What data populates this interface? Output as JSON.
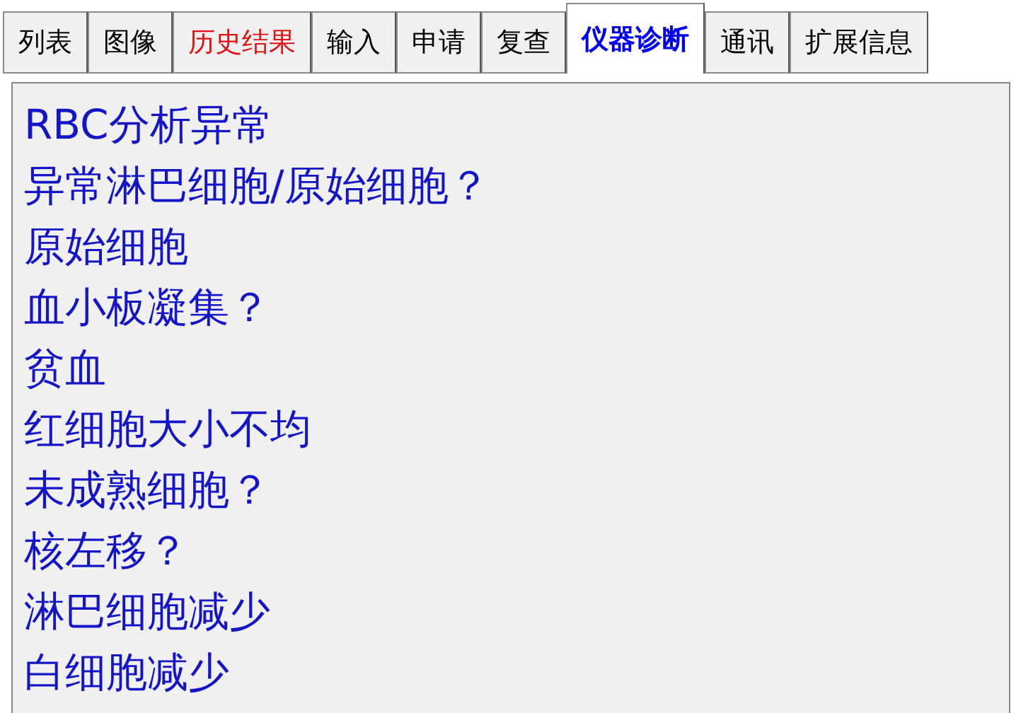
{
  "tabs": [
    {
      "label": "列表",
      "selected": false,
      "color": "#000000"
    },
    {
      "label": "图像",
      "selected": false,
      "color": "#000000"
    },
    {
      "label": "历史结果",
      "selected": false,
      "color": "#e01010"
    },
    {
      "label": "输入",
      "selected": false,
      "color": "#000000"
    },
    {
      "label": "申请",
      "selected": false,
      "color": "#000000"
    },
    {
      "label": "复查",
      "selected": false,
      "color": "#000000"
    },
    {
      "label": "仪器诊断",
      "selected": true,
      "color": "#0000ee"
    },
    {
      "label": "通讯",
      "selected": false,
      "color": "#000000"
    },
    {
      "label": "扩展信息",
      "selected": false,
      "color": "#000000"
    }
  ],
  "messages": [
    "RBC分析异常",
    "异常淋巴细胞/原始细胞？",
    "原始细胞",
    "血小板凝集？",
    "贫血",
    "红细胞大小不均",
    "未成熟细胞？",
    "核左移？",
    "淋巴细胞减少",
    "白细胞减少"
  ]
}
